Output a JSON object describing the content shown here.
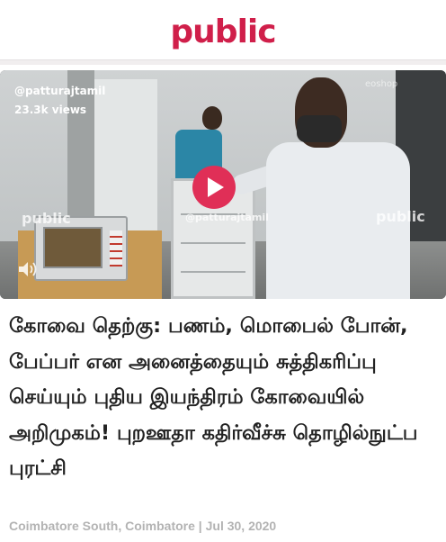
{
  "header": {
    "logo_text": "public",
    "brand_color": "#d01f4a"
  },
  "video": {
    "handle": "@patturajtamil",
    "views": "23.3k views",
    "watermark_center": "@patturajtamil",
    "watermark_left": "public",
    "watermark_right": "public",
    "watermark_shop": "eoshop",
    "play_icon": "play-icon",
    "sound_icon": "speaker-icon",
    "play_color": "#e02f57"
  },
  "article": {
    "title": "கோவை தெற்கு: பணம், மொபைல் போன், பேப்பர் என அனைத்தையும் சுத்திகரிப்பு செய்யும் புதிய இயந்திரம் கோவையில் அறிமுகம்! புறஊதா கதிர்வீச்சு தொழில்நுட்ப புரட்சி",
    "location": "Coimbatore South, Coimbatore",
    "separator": "|",
    "date": "Jul 30, 2020"
  }
}
